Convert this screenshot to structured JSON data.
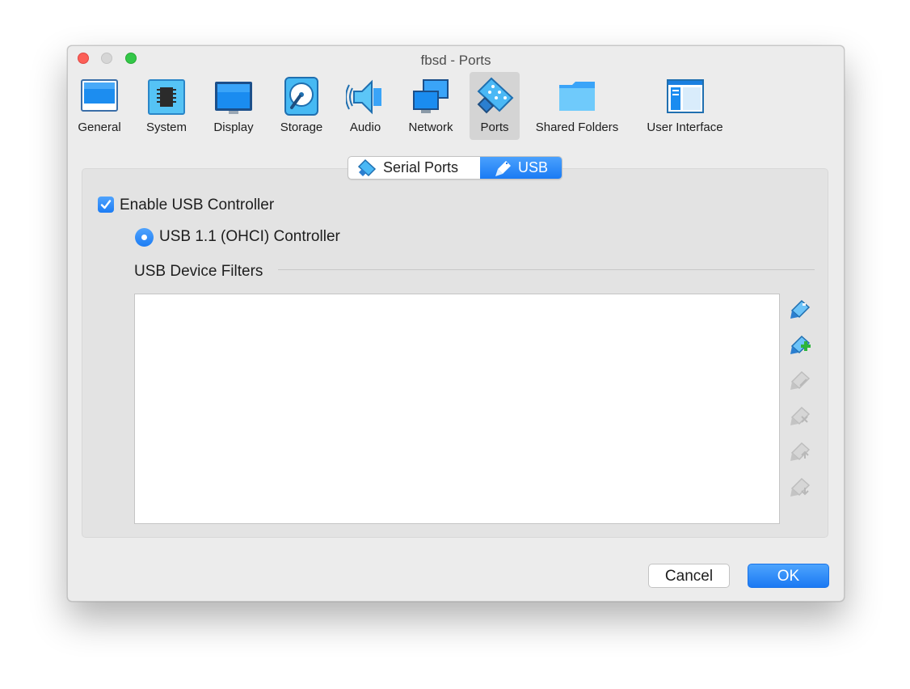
{
  "window": {
    "title": "fbsd - Ports"
  },
  "toolbar": {
    "items": [
      {
        "label": "General",
        "icon": "general-icon"
      },
      {
        "label": "System",
        "icon": "system-chip-icon"
      },
      {
        "label": "Display",
        "icon": "display-monitor-icon"
      },
      {
        "label": "Storage",
        "icon": "storage-disk-icon"
      },
      {
        "label": "Audio",
        "icon": "audio-speaker-icon"
      },
      {
        "label": "Network",
        "icon": "network-icon"
      },
      {
        "label": "Ports",
        "icon": "ports-connector-icon",
        "selected": true
      },
      {
        "label": "Shared Folders",
        "icon": "folder-icon"
      },
      {
        "label": "User Interface",
        "icon": "user-interface-icon"
      }
    ]
  },
  "tabs": {
    "serial": "Serial Ports",
    "usb": "USB",
    "selected": "USB"
  },
  "usb": {
    "enable_label": "Enable USB Controller",
    "enable_checked": true,
    "controller_label": "USB 1.1 (OHCI) Controller",
    "controller_selected": true,
    "filters_heading": "USB Device Filters",
    "filters": []
  },
  "side_buttons": [
    {
      "icon": "usb-add-filter-icon",
      "enabled": true
    },
    {
      "icon": "usb-add-from-device-icon",
      "enabled": true
    },
    {
      "icon": "usb-edit-filter-icon",
      "enabled": false
    },
    {
      "icon": "usb-remove-filter-icon",
      "enabled": false
    },
    {
      "icon": "usb-move-up-icon",
      "enabled": false
    },
    {
      "icon": "usb-move-down-icon",
      "enabled": false
    }
  ],
  "footer": {
    "cancel": "Cancel",
    "ok": "OK"
  },
  "colors": {
    "accent": "#1d7ef5",
    "window_bg": "#ececec",
    "panel_bg": "#e3e3e3"
  }
}
